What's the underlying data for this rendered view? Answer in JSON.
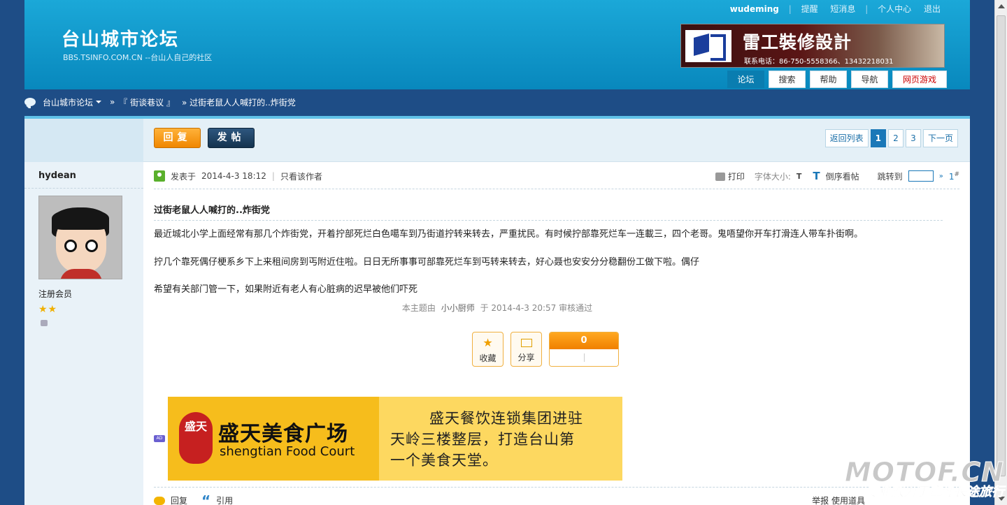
{
  "header": {
    "logo_title": "台山城市论坛",
    "logo_subtitle": "BBS.TSINFO.COM.CN --台山人自己的社区",
    "username": "wudeming",
    "links": [
      "提醒",
      "短消息",
      "个人中心",
      "退出"
    ],
    "banner_title": "雷工裝修設計",
    "banner_phone": "联系电话：86-750-5558366、13432218031",
    "nav_tabs": [
      "论坛",
      "搜索",
      "帮助",
      "导航",
      "网页游戏"
    ]
  },
  "breadcrumb": {
    "home": "台山城市论坛",
    "sep": "»",
    "board": "『 街谈巷议 』",
    "thread": "» 过街老鼠人人喊打的..炸街党"
  },
  "toolbar": {
    "reply_label": "回复",
    "post_label": "发帖",
    "pager": {
      "back": "返回列表",
      "current": "1",
      "pages": [
        "2",
        "3"
      ],
      "next": "下一页"
    }
  },
  "author": {
    "name": "hydean",
    "rank": "注册会员",
    "stars": "★★"
  },
  "post": {
    "posted_at_label": "发表于",
    "posted_at": "2014-4-3 18:12",
    "bar": "|",
    "only_author": "只看该作者",
    "print": "打印",
    "font_size": "字体大小:",
    "t_small": "T",
    "t_large": "T",
    "reverse": "倒序看帖",
    "jump": "跳转到",
    "jump_arrow": "»",
    "floor": "1",
    "floor_sup": "#",
    "title": "过街老鼠人人喊打的..炸街党",
    "paragraphs": [
      "最近城北小学上面经常有那几个炸街党，开着拧部死烂白色噶车到乃街道拧转来转去，严重扰民。有时候拧部靠死烂车一连載三，四个老哥。鬼唔望你开车打滑连人带车扑街啊。",
      "拧几个靠死偶仔梗系乡下上来租间房到丐附近住啦。日日无所事事可部靠死烂车到丐转来转去，好心聂也安安分分稳翻份工做下啦。偶仔",
      "希望有关部门管一下，如果附近有老人有心脏病的迟早被他们吓死"
    ],
    "audit_prefix": "本主题由",
    "audit_user": "小小厨师",
    "audit_mid": "于",
    "audit_time": "2014-4-3 20:57",
    "audit_suffix": "审核通过"
  },
  "actions": {
    "favorite": "收藏",
    "share": "分享",
    "score": "0"
  },
  "ad": {
    "tag": "AD",
    "seal": "盛天",
    "cn_name": "盛天美食广场",
    "en_name": "shengtian Food Court",
    "slogan_1": "盛天餐饮连锁集团进驻",
    "slogan_2": "天岭三楼整层，打造台山第",
    "slogan_3": "一个美食天堂。"
  },
  "footer_actions": {
    "reply": "回复",
    "quote": "引用",
    "tools": "举报  使用道具"
  },
  "watermark": {
    "big": "MOTOF.CN",
    "small": "专业致力于摩托长途旅行"
  }
}
